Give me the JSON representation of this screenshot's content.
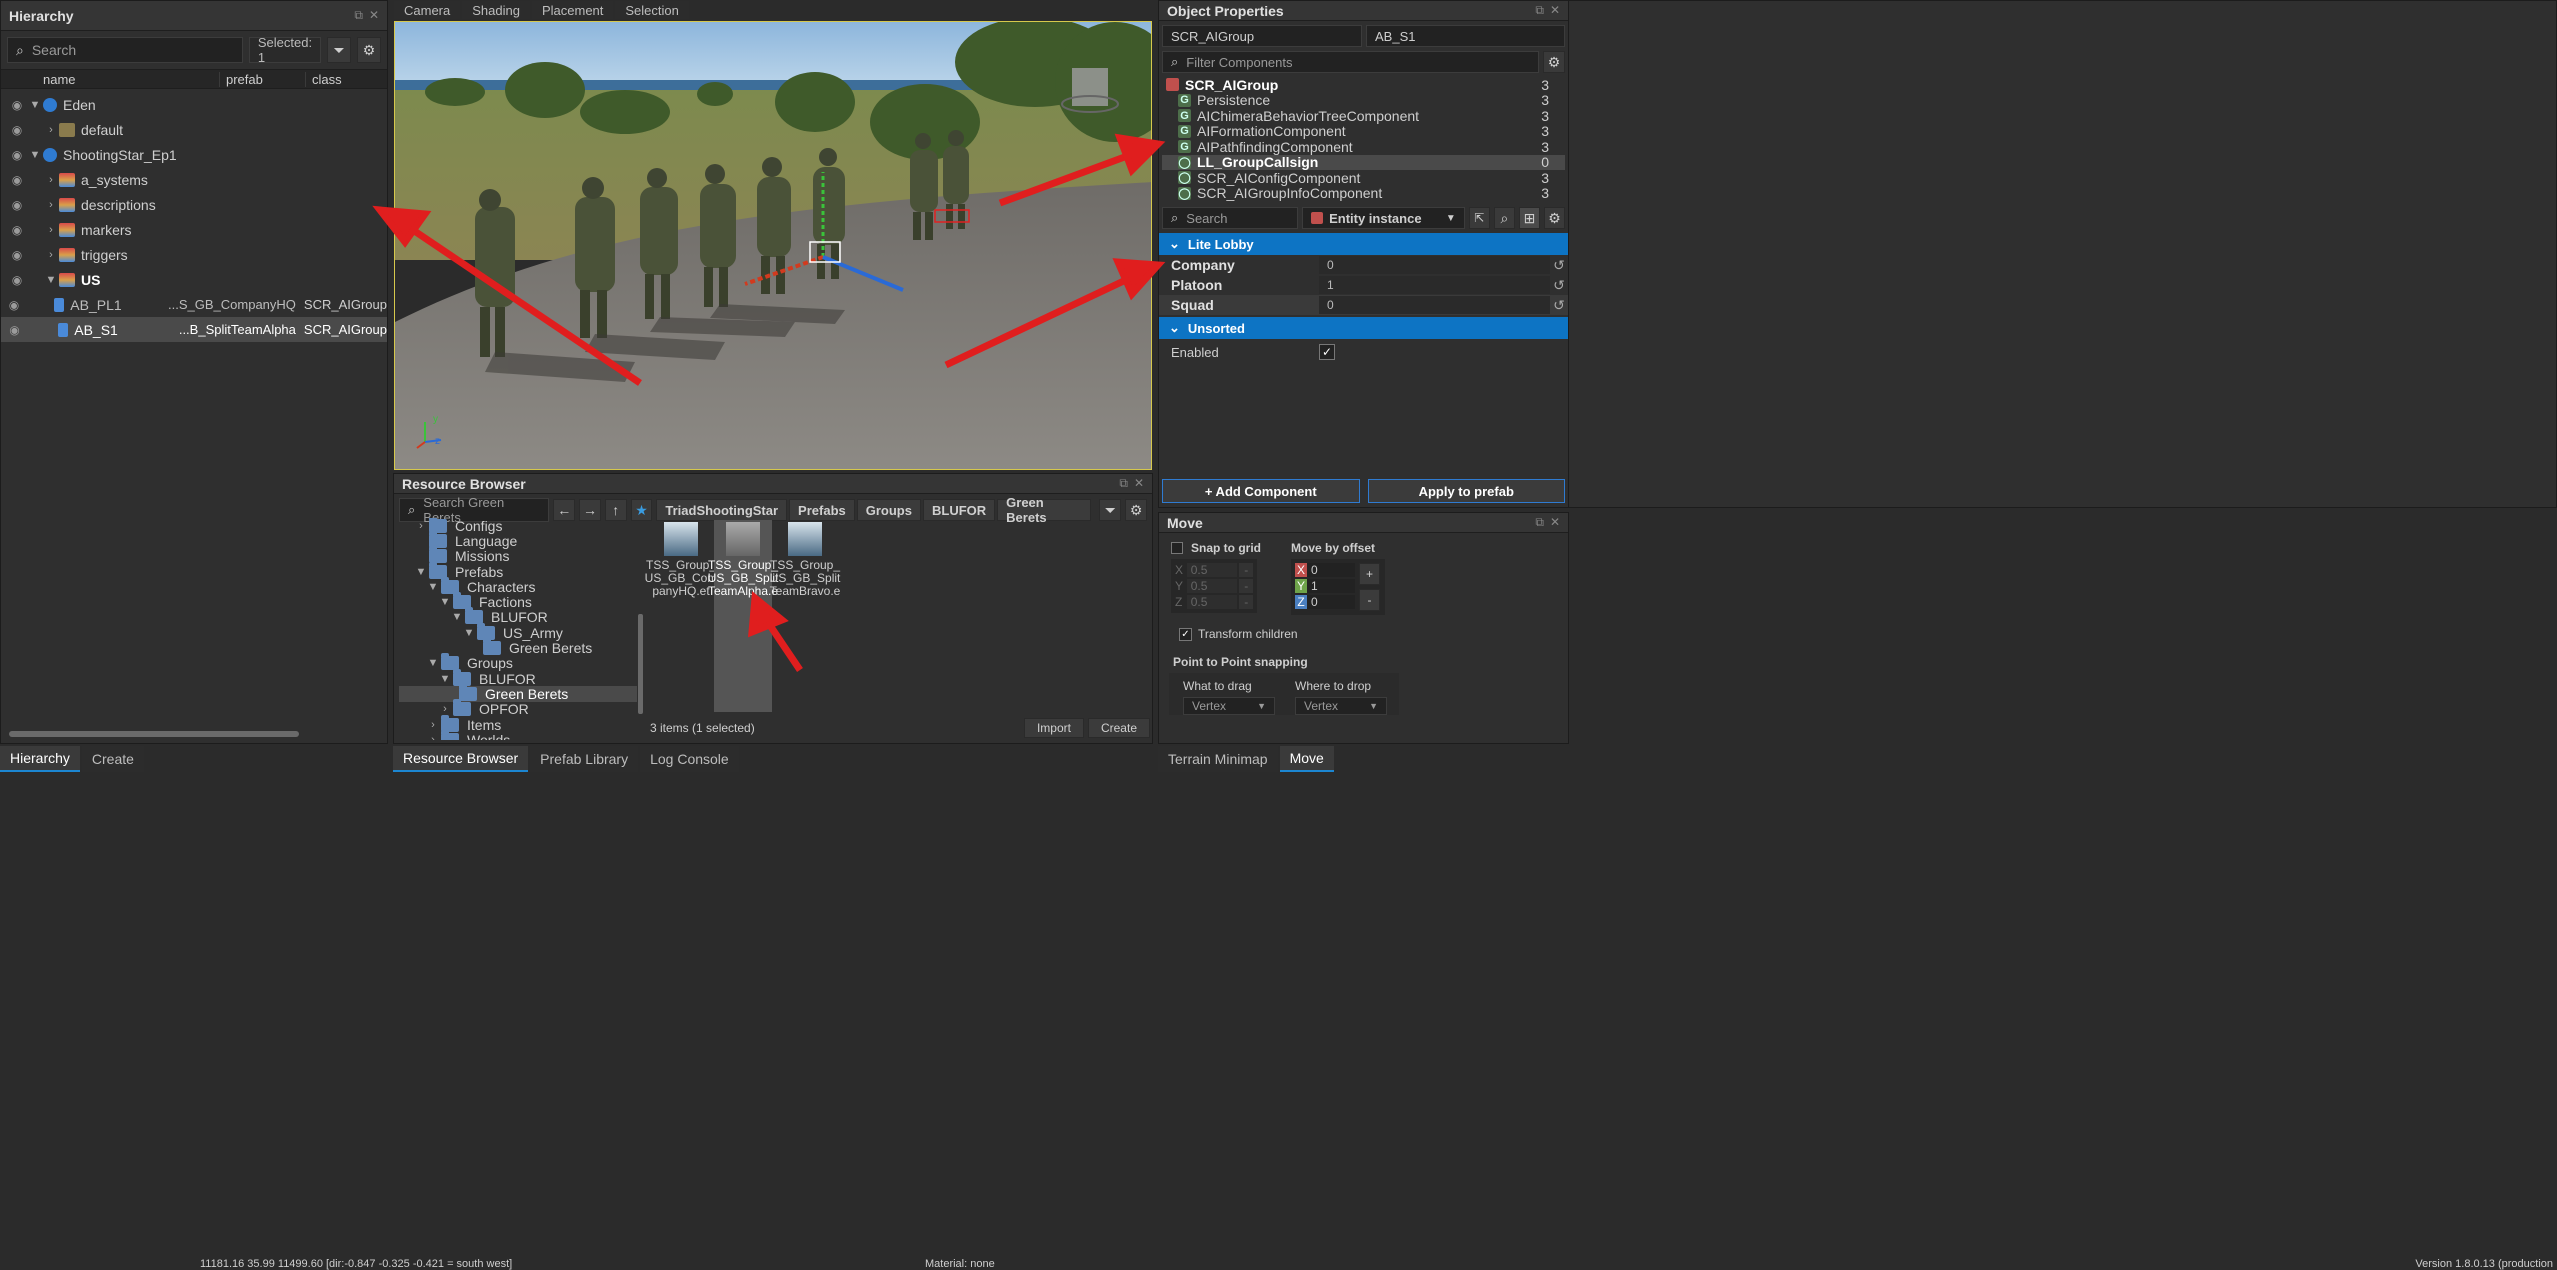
{
  "hierarchy": {
    "title": "Hierarchy",
    "search_placeholder": "Search",
    "selected_text": "Selected: 1",
    "columns": {
      "name": "name",
      "prefab": "prefab",
      "class": "class"
    },
    "rows": [
      {
        "label": "Eden",
        "prefab": "",
        "cls": ""
      },
      {
        "label": "default",
        "prefab": "",
        "cls": ""
      },
      {
        "label": "ShootingStar_Ep1",
        "prefab": "",
        "cls": ""
      },
      {
        "label": "a_systems",
        "prefab": "",
        "cls": ""
      },
      {
        "label": "descriptions",
        "prefab": "",
        "cls": ""
      },
      {
        "label": "markers",
        "prefab": "",
        "cls": ""
      },
      {
        "label": "triggers",
        "prefab": "",
        "cls": ""
      },
      {
        "label": "US",
        "prefab": "",
        "cls": ""
      },
      {
        "label": "AB_PL1",
        "prefab": "...S_GB_CompanyHQ",
        "cls": "SCR_AIGroup"
      },
      {
        "label": "AB_S1",
        "prefab": "...B_SplitTeamAlpha",
        "cls": "SCR_AIGroup"
      }
    ],
    "tabs": [
      "Hierarchy",
      "Create"
    ]
  },
  "viewport": {
    "tabs": [
      "Camera",
      "Shading",
      "Placement",
      "Selection"
    ],
    "axis_labels": {
      "y": "y",
      "x": "x",
      "z": "z"
    }
  },
  "resource_browser": {
    "title": "Resource Browser",
    "search_placeholder": "Search Green Berets",
    "breadcrumb": [
      "TriadShootingStar",
      "Prefabs",
      "Groups",
      "BLUFOR",
      "Green Berets"
    ],
    "tree": [
      {
        "label": "Configs"
      },
      {
        "label": "Language"
      },
      {
        "label": "Missions"
      },
      {
        "label": "Prefabs"
      },
      {
        "label": "Characters"
      },
      {
        "label": "Factions"
      },
      {
        "label": "BLUFOR"
      },
      {
        "label": "US_Army"
      },
      {
        "label": "Green Berets"
      },
      {
        "label": "Groups"
      },
      {
        "label": "BLUFOR"
      },
      {
        "label": "Green Berets"
      },
      {
        "label": "OPFOR"
      },
      {
        "label": "Items"
      },
      {
        "label": "Worlds"
      }
    ],
    "files": [
      {
        "lines": [
          "TSS_Group_",
          "US_GB_Com",
          "panyHQ.et"
        ]
      },
      {
        "lines": [
          "TSS_Group_",
          "US_GB_Split",
          "TeamAlpha.e"
        ]
      },
      {
        "lines": [
          "TSS_Group_",
          "US_GB_Split",
          "TeamBravo.e"
        ]
      }
    ],
    "status": "3 items (1 selected)",
    "import_label": "Import",
    "create_label": "Create",
    "tabs": [
      "Resource Browser",
      "Prefab Library",
      "Log Console"
    ]
  },
  "object_properties": {
    "title": "Object Properties",
    "class_field": "SCR_AIGroup",
    "name_field": "AB_S1",
    "filter_placeholder": "Filter Components",
    "components": [
      {
        "label": "SCR_AIGroup",
        "count": "3"
      },
      {
        "label": "Persistence",
        "count": "3"
      },
      {
        "label": "AIChimeraBehaviorTreeComponent",
        "count": "3"
      },
      {
        "label": "AIFormationComponent",
        "count": "3"
      },
      {
        "label": "AIPathfindingComponent",
        "count": "3"
      },
      {
        "label": "LL_GroupCallsign",
        "count": "0"
      },
      {
        "label": "SCR_AIConfigComponent",
        "count": "3"
      },
      {
        "label": "SCR_AIGroupInfoComponent",
        "count": "3"
      }
    ],
    "search_placeholder": "Search",
    "entity_select": "Entity instance",
    "section_lobby": "Lite Lobby",
    "fields": [
      {
        "label": "Company",
        "value": "0"
      },
      {
        "label": "Platoon",
        "value": "1"
      },
      {
        "label": "Squad",
        "value": "0"
      }
    ],
    "section_unsorted": "Unsorted",
    "enabled_label": "Enabled",
    "add_component": "+ Add Component",
    "apply_prefab": "Apply to prefab"
  },
  "move": {
    "title": "Move",
    "snap_label": "Snap to grid",
    "offset_label": "Move by offset",
    "grid_values": [
      "0.5",
      "0.5",
      "0.5"
    ],
    "axes": [
      "X",
      "Y",
      "Z"
    ],
    "offset_values": [
      "0",
      "1",
      "0"
    ],
    "plus": "+",
    "minus": "-",
    "transform_children": "Transform children",
    "p2p_label": "Point to Point snapping",
    "what_label": "What to drag",
    "where_label": "Where to drop",
    "what_value": "Vertex",
    "where_value": "Vertex",
    "tabs": [
      "Terrain Minimap",
      "Move"
    ]
  },
  "statusbar": {
    "coords": "11181.16     35.99  11499.60 [dir:-0.847 -0.325 -0.421 = south west]",
    "material": "Material: none",
    "version": "Version 1.8.0.13 (production"
  }
}
